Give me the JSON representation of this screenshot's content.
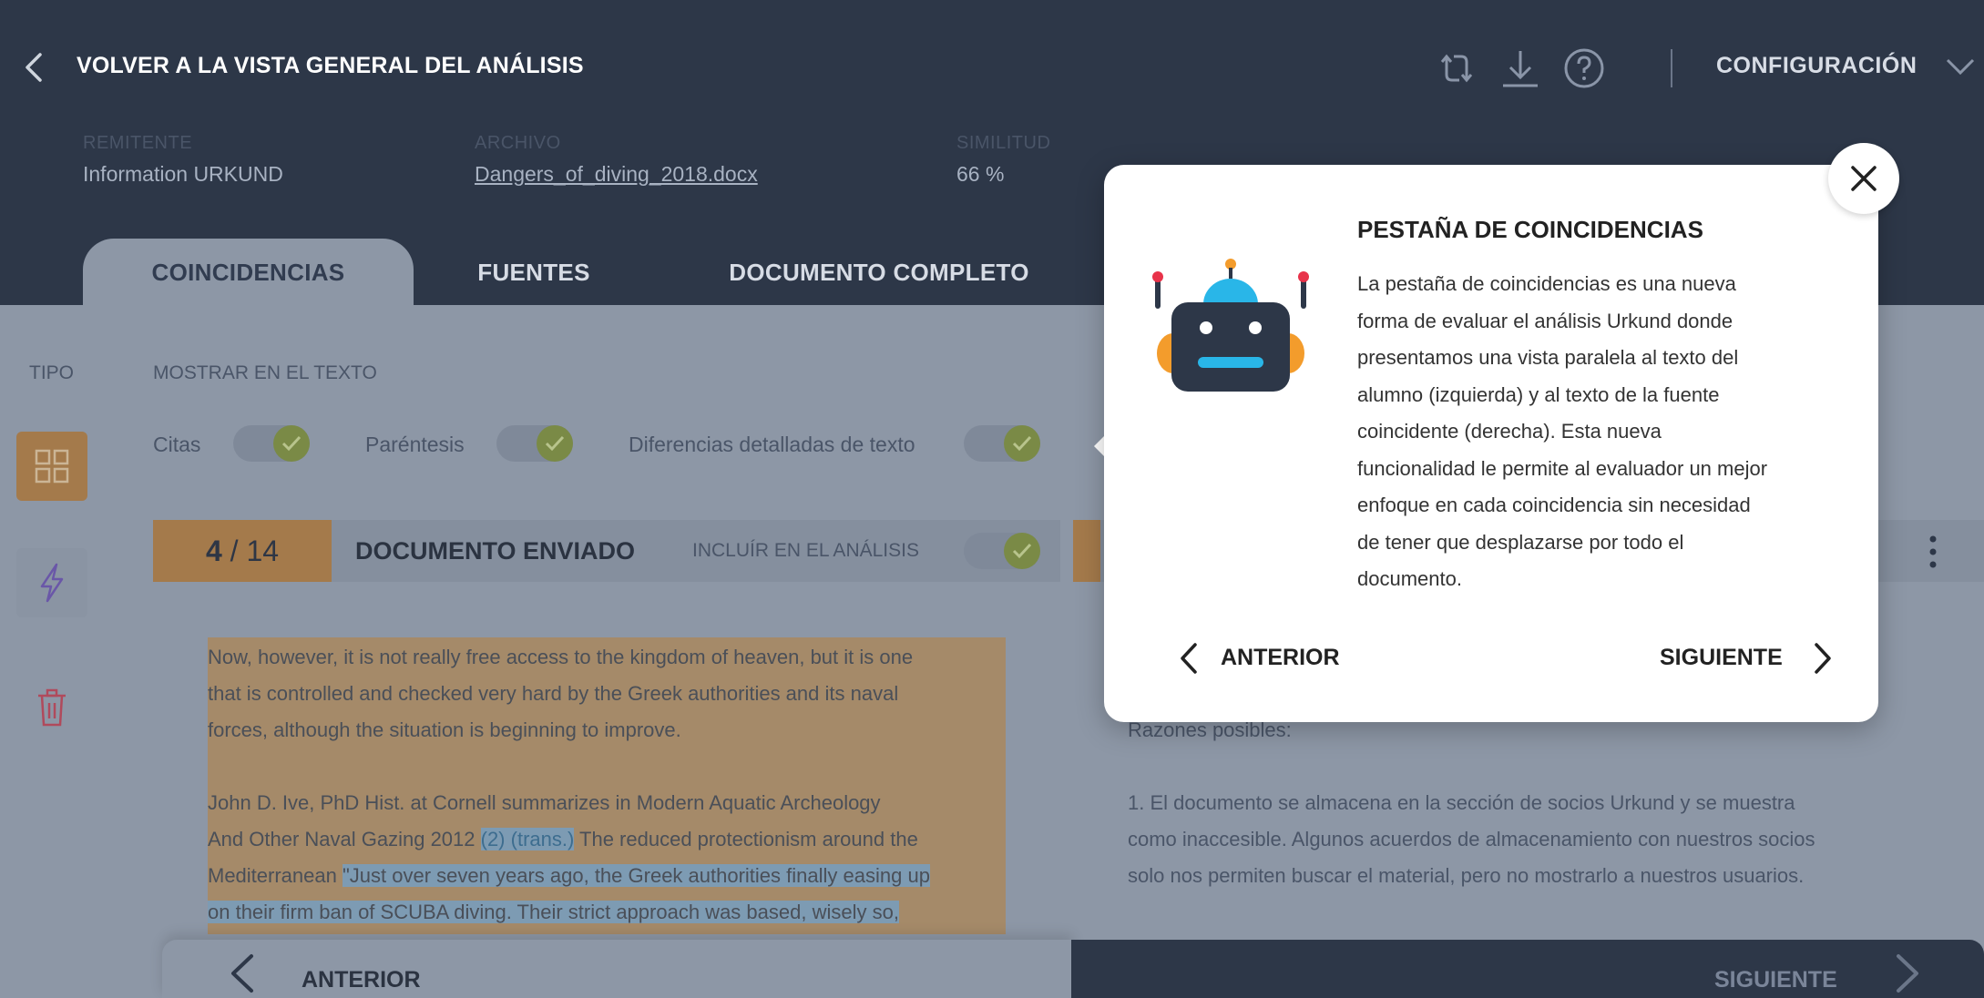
{
  "header": {
    "back_label": "VOLVER A LA VISTA GENERAL DEL ANÁLISIS",
    "config_label": "CONFIGURACIÓN",
    "meta": {
      "sender_key": "REMITENTE",
      "sender_val": "Information URKUND",
      "file_key": "ARCHIVO",
      "file_val": "Dangers_of_diving_2018.docx",
      "similarity_key": "SIMILITUD",
      "similarity_val": "66 %"
    },
    "tabs": [
      "COINCIDENCIAS",
      "FUENTES",
      "DOCUMENTO COMPLETO"
    ]
  },
  "filters": {
    "type_label": "TIPO",
    "show_label": "MOSTRAR EN EL TEXTO",
    "toggles": [
      "Citas",
      "Paréntesis",
      "Diferencias detalladas de texto"
    ]
  },
  "submitted": {
    "counter_current": "4",
    "counter_total": " / 14",
    "title": "DOCUMENTO ENVIADO",
    "include_label": "INCLUÍR EN EL ANÁLISIS",
    "lines": {
      "l1": "Now, however, it is not really free access to the kingdom of heaven, but it is one",
      "l2": "that is controlled and checked very hard by the Greek authorities and its naval",
      "l3": "forces, although the situation is beginning to improve.",
      "l4": "John D. Ive, PhD Hist. at Cornell summarizes in Modern Aquatic Archeology",
      "l5a": "And Other Naval Gazing 2012 ",
      "l5ref": "(2) (trans.)",
      "l5b": " The reduced protectionism around the",
      "l6a": "Mediterranean ",
      "l6b": "\"Just over seven years ago, the Greek authorities finally easing up",
      "l7": "on their firm ban of SCUBA diving. Their strict approach was based, wisely so,"
    }
  },
  "source": {
    "reasons_label": "Razones posibles:",
    "lines": [
      "1. El documento se almacena en la sección de socios Urkund y se muestra",
      "como inaccesible. Algunos acuerdos de almacenamiento con nuestros socios",
      "solo nos permiten buscar el material, pero no mostrarlo a nuestros usuarios."
    ]
  },
  "footer": {
    "prev_label": "ANTERIOR",
    "next_label": "SIGUIENTE"
  },
  "popup": {
    "title": "PESTAÑA DE COINCIDENCIAS",
    "body_lines": [
      "La pestaña de coincidencias es una nueva",
      "forma de evaluar el análisis Urkund donde",
      "presentamos una vista paralela al texto del",
      "alumno (izquierda) y al texto de la fuente",
      "coincidente (derecha). Esta nueva",
      "funcionalidad le permite al evaluador un mejor",
      "enfoque en cada coincidencia sin necesidad",
      "de tener que desplazarse por todo el",
      "documento."
    ],
    "prev_label": "ANTERIOR",
    "next_label": "SIGUIENTE"
  },
  "icons": {
    "back": "chevron-left-icon",
    "refresh": "refresh-icon",
    "download": "download-icon",
    "help": "help-icon",
    "config": "chevron-down-icon",
    "grid": "grid-icon",
    "flash": "flash-icon",
    "trash": "trash-icon",
    "kebab": "kebab-menu-icon",
    "close": "close-icon",
    "robot": "robot-illustration"
  },
  "colors": {
    "header_bg": "#2d3748",
    "overlay_bg": "#8d97a6",
    "accent_orange": "#a47a4b",
    "toggle_on": "#7a8a46",
    "popup_bg": "#ffffff",
    "robot_blue": "#29b6e8",
    "robot_orange": "#f39c2c",
    "robot_red": "#e8334a"
  }
}
